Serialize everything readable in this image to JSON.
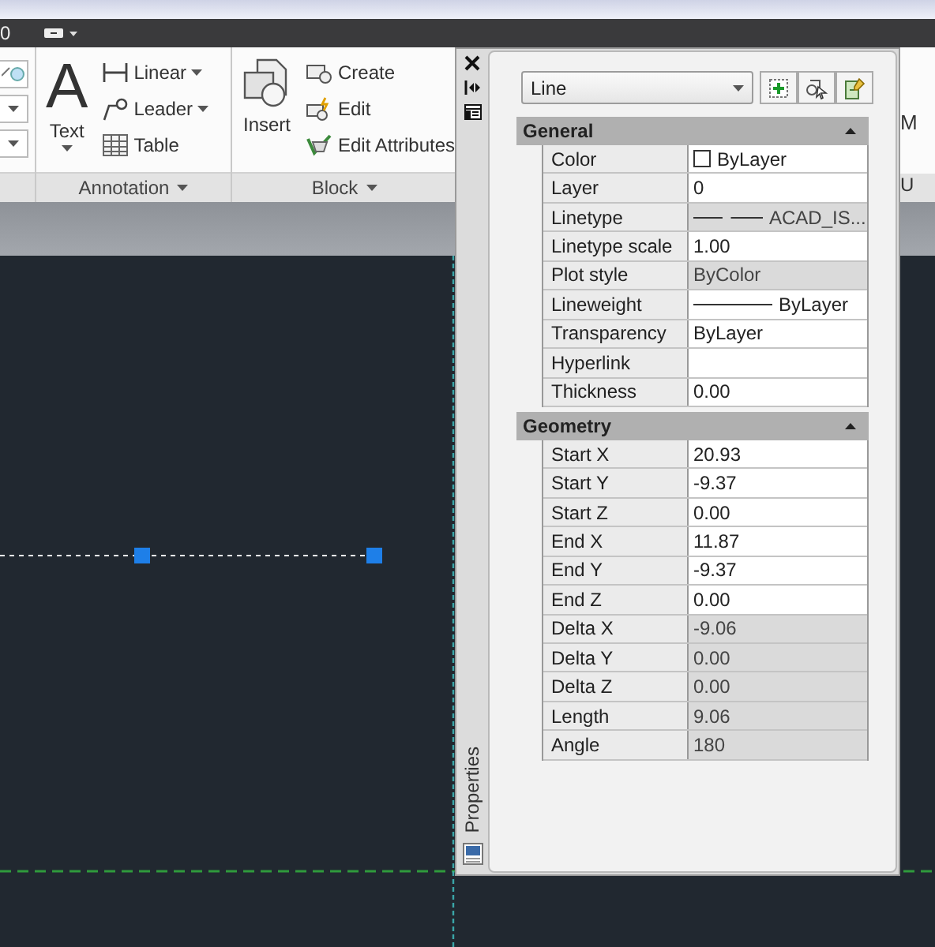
{
  "top_bar": {
    "label": "0"
  },
  "ribbon": {
    "panels": [
      {
        "title": "Annotation",
        "dropdown": true,
        "tools": [
          {
            "kind": "large",
            "glyph": "A",
            "label": "Text",
            "dropdown": true
          },
          {
            "kind": "small",
            "label": "Linear",
            "dropdown": true
          },
          {
            "kind": "small",
            "label": "Leader",
            "dropdown": true
          },
          {
            "kind": "small",
            "label": "Table",
            "dropdown": false
          }
        ]
      },
      {
        "title": "Block",
        "dropdown": true,
        "tools": [
          {
            "kind": "large",
            "label": "Insert",
            "dropdown": false
          },
          {
            "kind": "small",
            "label": "Create",
            "dropdown": false
          },
          {
            "kind": "small",
            "label": "Edit",
            "dropdown": false
          },
          {
            "kind": "small",
            "label": "Edit Attributes",
            "dropdown": false
          }
        ]
      }
    ],
    "partial_panel": {
      "label": "M",
      "title": "U"
    }
  },
  "palette": {
    "title": "Properties",
    "object_type": "Line",
    "sections": [
      {
        "title": "General",
        "expanded": true,
        "rows": [
          {
            "label": "Color",
            "value": "ByLayer",
            "kind": "color",
            "readonly": false
          },
          {
            "label": "Layer",
            "value": "0",
            "kind": "text",
            "readonly": false
          },
          {
            "label": "Linetype",
            "value": "ACAD_IS...",
            "kind": "linetype",
            "readonly": true
          },
          {
            "label": "Linetype scale",
            "value": "1.00",
            "kind": "text",
            "readonly": false
          },
          {
            "label": "Plot style",
            "value": "ByColor",
            "kind": "text",
            "readonly": true
          },
          {
            "label": "Lineweight",
            "value": "ByLayer",
            "kind": "lineweight",
            "readonly": false
          },
          {
            "label": "Transparency",
            "value": "ByLayer",
            "kind": "text",
            "readonly": false
          },
          {
            "label": "Hyperlink",
            "kind": "text",
            "readonly": false
          },
          {
            "label": "Thickness",
            "value": "0.00",
            "kind": "text",
            "readonly": false
          }
        ]
      },
      {
        "title": "Geometry",
        "expanded": true,
        "rows": [
          {
            "label": "Start X",
            "value": "20.93",
            "kind": "text",
            "readonly": false
          },
          {
            "label": "Start Y",
            "value": "-9.37",
            "kind": "text",
            "readonly": false
          },
          {
            "label": "Start Z",
            "value": "0.00",
            "kind": "text",
            "readonly": false
          },
          {
            "label": "End X",
            "value": "11.87",
            "kind": "text",
            "readonly": false
          },
          {
            "label": "End Y",
            "value": "-9.37",
            "kind": "text",
            "readonly": false
          },
          {
            "label": "End Z",
            "value": "0.00",
            "kind": "text",
            "readonly": false
          },
          {
            "label": "Delta X",
            "value": "-9.06",
            "kind": "text",
            "readonly": true
          },
          {
            "label": "Delta Y",
            "value": "0.00",
            "kind": "text",
            "readonly": true
          },
          {
            "label": "Delta Z",
            "value": "0.00",
            "kind": "text",
            "readonly": true
          },
          {
            "label": "Length",
            "value": "9.06",
            "kind": "text",
            "readonly": true
          },
          {
            "label": "Angle",
            "value": "180",
            "kind": "text",
            "readonly": true
          }
        ]
      }
    ]
  }
}
